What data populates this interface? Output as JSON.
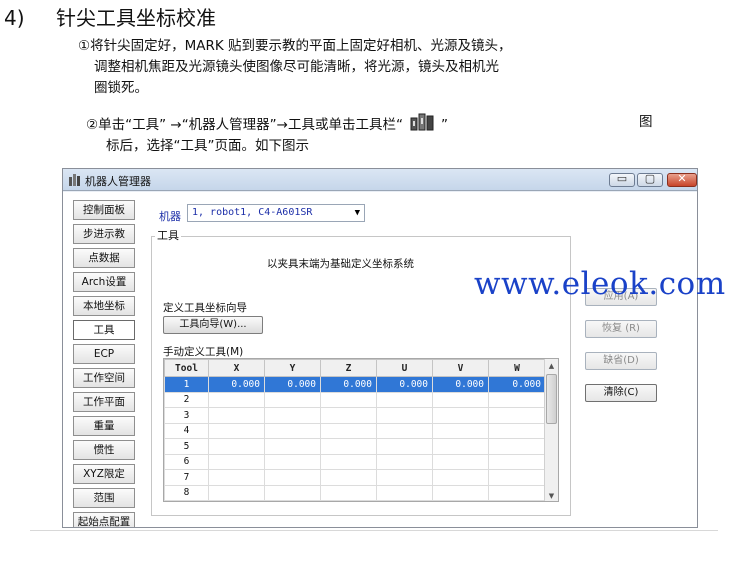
{
  "heading": {
    "number": "4)",
    "text": "针尖工具坐标校准"
  },
  "paragraph1": {
    "line1": "①将针尖固定好，MARK 贴到要示教的平面上固定好相机、光源及镜头，",
    "line2": "调整相机焦距及光源镜头使图像尽可能清晰，将光源，镜头及相机光",
    "line3": "圈锁死。"
  },
  "paragraph2": {
    "line1_before_icon": "②单击“工具” →“机器人管理器”→工具或单击工具栏“",
    "line1_after_icon": "”",
    "line1_end": "图",
    "line2": "标后，选择“工具”页面。如下图示"
  },
  "window": {
    "title": "机器人管理器",
    "buttons": {
      "minimize": "▭",
      "maximize": "▢",
      "close": "✕"
    }
  },
  "sidebar": {
    "items": [
      {
        "label": "控制面板"
      },
      {
        "label": "步进示教"
      },
      {
        "label": "点数据"
      },
      {
        "label": "Arch设置"
      },
      {
        "label": "本地坐标"
      },
      {
        "label": "工具"
      },
      {
        "label": "ECP"
      },
      {
        "label": "工作空间"
      },
      {
        "label": "工作平面"
      },
      {
        "label": "重量"
      },
      {
        "label": "惯性"
      },
      {
        "label": "XYZ限定"
      },
      {
        "label": "范围"
      },
      {
        "label": "起始点配置"
      }
    ],
    "active": "工具"
  },
  "robot": {
    "label": "机器",
    "value": "1, robot1, C4-A601SR"
  },
  "tool_group": {
    "title": "工具",
    "hint": "以夹具末端为基础定义坐标系统",
    "wizard_label": "定义工具坐标向导",
    "wizard_button": "工具向导(W)...",
    "manual_label": "手动定义工具(M)"
  },
  "grid": {
    "columns": [
      "Tool",
      "X",
      "Y",
      "Z",
      "U",
      "V",
      "W"
    ],
    "rows": [
      {
        "tool": "1",
        "x": "0.000",
        "y": "0.000",
        "z": "0.000",
        "u": "0.000",
        "v": "0.000",
        "w": "0.000"
      },
      {
        "tool": "2",
        "x": "",
        "y": "",
        "z": "",
        "u": "",
        "v": "",
        "w": ""
      },
      {
        "tool": "3",
        "x": "",
        "y": "",
        "z": "",
        "u": "",
        "v": "",
        "w": ""
      },
      {
        "tool": "4",
        "x": "",
        "y": "",
        "z": "",
        "u": "",
        "v": "",
        "w": ""
      },
      {
        "tool": "5",
        "x": "",
        "y": "",
        "z": "",
        "u": "",
        "v": "",
        "w": ""
      },
      {
        "tool": "6",
        "x": "",
        "y": "",
        "z": "",
        "u": "",
        "v": "",
        "w": ""
      },
      {
        "tool": "7",
        "x": "",
        "y": "",
        "z": "",
        "u": "",
        "v": "",
        "w": ""
      },
      {
        "tool": "8",
        "x": "",
        "y": "",
        "z": "",
        "u": "",
        "v": "",
        "w": ""
      }
    ]
  },
  "right_buttons": {
    "apply": "应用(A)",
    "restore": "恢复 (R)",
    "default": "缺省(D)",
    "clear": "清除(C)"
  },
  "watermark": "www.eleok.com",
  "colors": {
    "selection": "#3077d6",
    "watermark": "#1a42c8",
    "robot_label": "#1c2ea8"
  }
}
